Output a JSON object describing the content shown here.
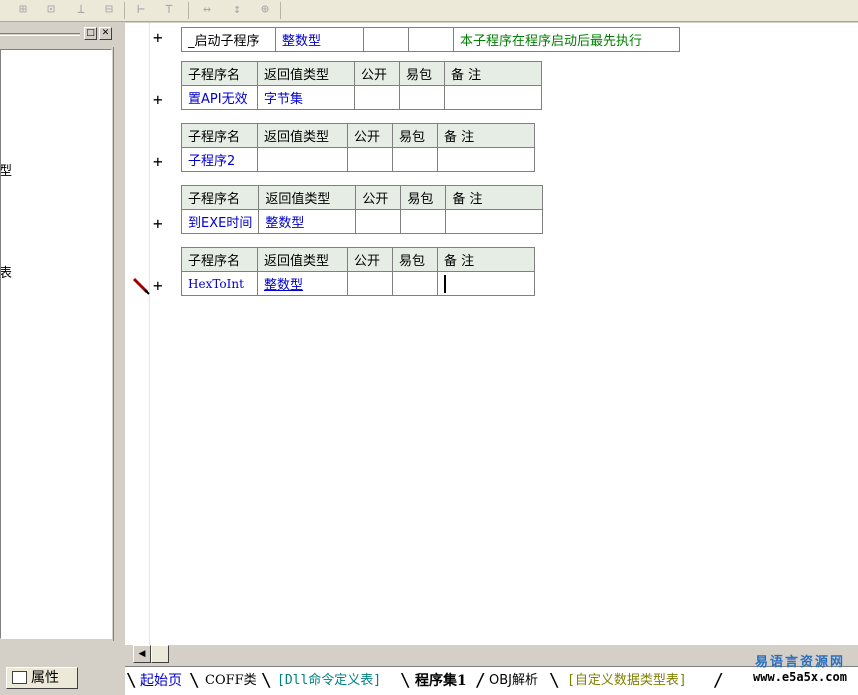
{
  "toolbar": {
    "icons": [
      "grid-icon",
      "frame-icon",
      "chart-icon",
      "layout-icon",
      "align-h-icon",
      "align-v-icon",
      "width-icon",
      "height-icon",
      "size-icon"
    ]
  },
  "left_panel": {
    "fragment_1": "型",
    "fragment_2": "表",
    "properties_label": "属性"
  },
  "main_sub": {
    "name": "_启动子程序",
    "return_type": "整数型",
    "note": "本子程序在程序启动后最先执行"
  },
  "headers": {
    "name": "子程序名",
    "return_type": "返回值类型",
    "public": "公开",
    "easy_pack": "易包",
    "note": "备 注"
  },
  "subs": [
    {
      "name": "置API无效",
      "return_type": "字节集",
      "public": "",
      "easy_pack": "",
      "note": ""
    },
    {
      "name": "子程序2",
      "return_type": "",
      "public": "",
      "easy_pack": "",
      "note": ""
    },
    {
      "name": "到EXE时间",
      "return_type": "整数型",
      "public": "",
      "easy_pack": "",
      "note": ""
    },
    {
      "name": "HexToInt",
      "return_type": "整数型",
      "public": "",
      "easy_pack": "",
      "note": ""
    }
  ],
  "tabs": [
    {
      "label": "起始页",
      "active": false,
      "color": "#0000cc"
    },
    {
      "label": "COFF类",
      "active": false,
      "color": "#000000"
    },
    {
      "label": "[Dll命令定义表]",
      "active": false,
      "color": "#008080"
    },
    {
      "label": "程序集1",
      "active": true,
      "color": "#000000"
    },
    {
      "label": "OBJ解析",
      "active": false,
      "color": "#000000"
    },
    {
      "label": "[自定义数据类型表]",
      "active": false,
      "color": "#808000"
    }
  ],
  "watermark": {
    "line1": "易语言资源网",
    "line2": "www.e5a5x.com"
  },
  "colors": {
    "header_bg": "#e5ede5",
    "type_text": "#0000cc",
    "note_text": "#008000"
  }
}
